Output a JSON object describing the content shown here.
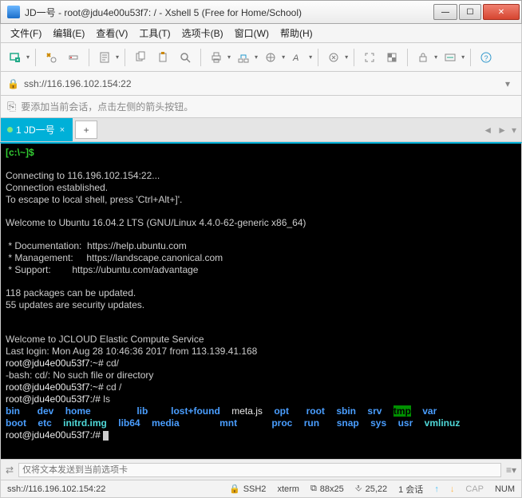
{
  "window": {
    "title": "JD一号 - root@jdu4e00u53f7: / - Xshell 5 (Free for Home/School)"
  },
  "menu": {
    "file": "文件(F)",
    "edit": "编辑(E)",
    "view": "查看(V)",
    "tools": "工具(T)",
    "tabs": "选项卡(B)",
    "window": "窗口(W)",
    "help": "帮助(H)"
  },
  "address": {
    "text": "ssh://116.196.102.154:22"
  },
  "info": {
    "text": "要添加当前会话，点击左侧的箭头按钮。"
  },
  "tab": {
    "label": "1 JD一号"
  },
  "terminal": {
    "prompt1": "[c:\\~]$",
    "l1": "Connecting to 116.196.102.154:22...",
    "l2": "Connection established.",
    "l3": "To escape to local shell, press 'Ctrl+Alt+]'.",
    "l4": "Welcome to Ubuntu 16.04.2 LTS (GNU/Linux 4.4.0-62-generic x86_64)",
    "l5": " * Documentation:  https://help.ubuntu.com",
    "l6": " * Management:     https://landscape.canonical.com",
    "l7": " * Support:        https://ubuntu.com/advantage",
    "l8": "118 packages can be updated.",
    "l9": "55 updates are security updates.",
    "l10": "Welcome to JCLOUD Elastic Compute Service",
    "l11": "Last login: Mon Aug 28 10:46:36 2017 from 113.139.41.168",
    "p2": "root@jdu4e00u53f7:~# ",
    "c2": "cd/",
    "l12": "-bash: cd/: No such file or directory",
    "p3": "root@jdu4e00u53f7:~# ",
    "c3": "cd /",
    "p4": "root@jdu4e00u53f7:/# ",
    "c4": "ls",
    "ls_row1": {
      "bin": "bin",
      "dev": "dev",
      "home": "home",
      "lib": "lib",
      "lostfound": "lost+found",
      "meta": "meta.js",
      "opt": "opt",
      "root": "root",
      "sbin": "sbin",
      "srv": "srv",
      "tmp": "tmp",
      "var": "var"
    },
    "ls_row2": {
      "boot": "boot",
      "etc": "etc",
      "initrd": "initrd.img",
      "lib64": "lib64",
      "media": "media",
      "mnt": "mnt",
      "proc": "proc",
      "run": "run",
      "snap": "snap",
      "sys": "sys",
      "usr": "usr",
      "vmlinuz": "vmlinuz"
    },
    "p5": "root@jdu4e00u53f7:/# "
  },
  "sendbar": {
    "placeholder": "仅将文本发送到当前选项卡"
  },
  "status": {
    "addr": "ssh://116.196.102.154:22",
    "ssh": "SSH2",
    "term": "xterm",
    "size": "88x25",
    "cursor": "25,22",
    "sessions": "1 会话",
    "cap": "CAP",
    "num": "NUM"
  }
}
